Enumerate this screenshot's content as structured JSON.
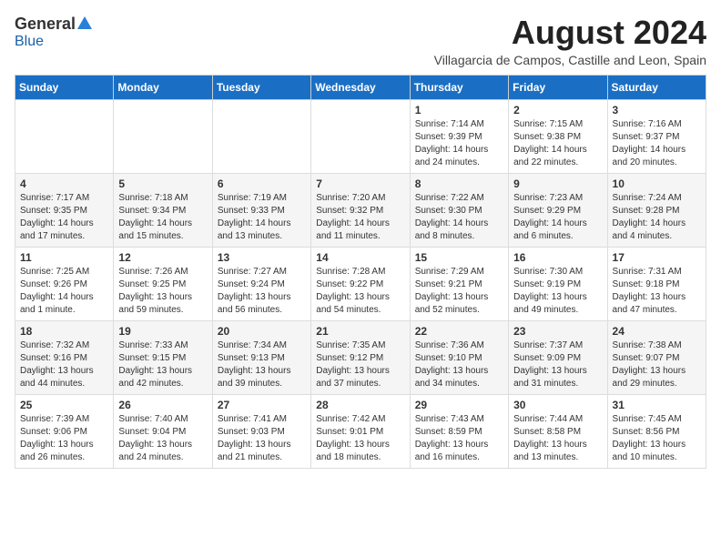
{
  "header": {
    "logo": {
      "general": "General",
      "blue": "Blue"
    },
    "title": "August 2024",
    "subtitle": "Villagarcia de Campos, Castille and Leon, Spain"
  },
  "weekdays": [
    "Sunday",
    "Monday",
    "Tuesday",
    "Wednesday",
    "Thursday",
    "Friday",
    "Saturday"
  ],
  "weeks": [
    [
      {
        "day": "",
        "info": ""
      },
      {
        "day": "",
        "info": ""
      },
      {
        "day": "",
        "info": ""
      },
      {
        "day": "",
        "info": ""
      },
      {
        "day": "1",
        "info": "Sunrise: 7:14 AM\nSunset: 9:39 PM\nDaylight: 14 hours and 24 minutes."
      },
      {
        "day": "2",
        "info": "Sunrise: 7:15 AM\nSunset: 9:38 PM\nDaylight: 14 hours and 22 minutes."
      },
      {
        "day": "3",
        "info": "Sunrise: 7:16 AM\nSunset: 9:37 PM\nDaylight: 14 hours and 20 minutes."
      }
    ],
    [
      {
        "day": "4",
        "info": "Sunrise: 7:17 AM\nSunset: 9:35 PM\nDaylight: 14 hours and 17 minutes."
      },
      {
        "day": "5",
        "info": "Sunrise: 7:18 AM\nSunset: 9:34 PM\nDaylight: 14 hours and 15 minutes."
      },
      {
        "day": "6",
        "info": "Sunrise: 7:19 AM\nSunset: 9:33 PM\nDaylight: 14 hours and 13 minutes."
      },
      {
        "day": "7",
        "info": "Sunrise: 7:20 AM\nSunset: 9:32 PM\nDaylight: 14 hours and 11 minutes."
      },
      {
        "day": "8",
        "info": "Sunrise: 7:22 AM\nSunset: 9:30 PM\nDaylight: 14 hours and 8 minutes."
      },
      {
        "day": "9",
        "info": "Sunrise: 7:23 AM\nSunset: 9:29 PM\nDaylight: 14 hours and 6 minutes."
      },
      {
        "day": "10",
        "info": "Sunrise: 7:24 AM\nSunset: 9:28 PM\nDaylight: 14 hours and 4 minutes."
      }
    ],
    [
      {
        "day": "11",
        "info": "Sunrise: 7:25 AM\nSunset: 9:26 PM\nDaylight: 14 hours and 1 minute."
      },
      {
        "day": "12",
        "info": "Sunrise: 7:26 AM\nSunset: 9:25 PM\nDaylight: 13 hours and 59 minutes."
      },
      {
        "day": "13",
        "info": "Sunrise: 7:27 AM\nSunset: 9:24 PM\nDaylight: 13 hours and 56 minutes."
      },
      {
        "day": "14",
        "info": "Sunrise: 7:28 AM\nSunset: 9:22 PM\nDaylight: 13 hours and 54 minutes."
      },
      {
        "day": "15",
        "info": "Sunrise: 7:29 AM\nSunset: 9:21 PM\nDaylight: 13 hours and 52 minutes."
      },
      {
        "day": "16",
        "info": "Sunrise: 7:30 AM\nSunset: 9:19 PM\nDaylight: 13 hours and 49 minutes."
      },
      {
        "day": "17",
        "info": "Sunrise: 7:31 AM\nSunset: 9:18 PM\nDaylight: 13 hours and 47 minutes."
      }
    ],
    [
      {
        "day": "18",
        "info": "Sunrise: 7:32 AM\nSunset: 9:16 PM\nDaylight: 13 hours and 44 minutes."
      },
      {
        "day": "19",
        "info": "Sunrise: 7:33 AM\nSunset: 9:15 PM\nDaylight: 13 hours and 42 minutes."
      },
      {
        "day": "20",
        "info": "Sunrise: 7:34 AM\nSunset: 9:13 PM\nDaylight: 13 hours and 39 minutes."
      },
      {
        "day": "21",
        "info": "Sunrise: 7:35 AM\nSunset: 9:12 PM\nDaylight: 13 hours and 37 minutes."
      },
      {
        "day": "22",
        "info": "Sunrise: 7:36 AM\nSunset: 9:10 PM\nDaylight: 13 hours and 34 minutes."
      },
      {
        "day": "23",
        "info": "Sunrise: 7:37 AM\nSunset: 9:09 PM\nDaylight: 13 hours and 31 minutes."
      },
      {
        "day": "24",
        "info": "Sunrise: 7:38 AM\nSunset: 9:07 PM\nDaylight: 13 hours and 29 minutes."
      }
    ],
    [
      {
        "day": "25",
        "info": "Sunrise: 7:39 AM\nSunset: 9:06 PM\nDaylight: 13 hours and 26 minutes."
      },
      {
        "day": "26",
        "info": "Sunrise: 7:40 AM\nSunset: 9:04 PM\nDaylight: 13 hours and 24 minutes."
      },
      {
        "day": "27",
        "info": "Sunrise: 7:41 AM\nSunset: 9:03 PM\nDaylight: 13 hours and 21 minutes."
      },
      {
        "day": "28",
        "info": "Sunrise: 7:42 AM\nSunset: 9:01 PM\nDaylight: 13 hours and 18 minutes."
      },
      {
        "day": "29",
        "info": "Sunrise: 7:43 AM\nSunset: 8:59 PM\nDaylight: 13 hours and 16 minutes."
      },
      {
        "day": "30",
        "info": "Sunrise: 7:44 AM\nSunset: 8:58 PM\nDaylight: 13 hours and 13 minutes."
      },
      {
        "day": "31",
        "info": "Sunrise: 7:45 AM\nSunset: 8:56 PM\nDaylight: 13 hours and 10 minutes."
      }
    ]
  ]
}
